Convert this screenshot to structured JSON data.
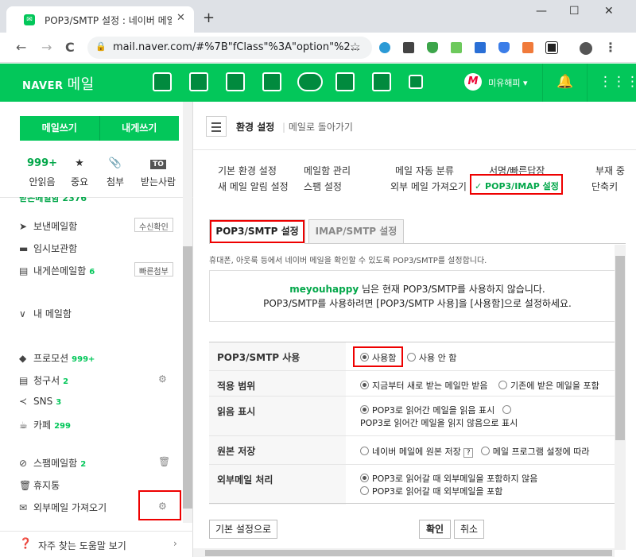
{
  "browser": {
    "tab_title": "POP3/SMTP 설정 : 네이버 메일",
    "tab_close": "✕",
    "new_tab": "+",
    "url": "mail.naver.com/#%7B\"fClass\"%3A\"option\"%2...",
    "win_min": "—",
    "win_max": "☐",
    "win_close": "✕",
    "back": "←",
    "forward": "→",
    "reload": "C",
    "menu": "⋮"
  },
  "header": {
    "brand": "NAVER",
    "product": "메일",
    "user_initial": "M",
    "user_name": "미유해피 ▾"
  },
  "sidebar": {
    "write_label": "메일쓰기",
    "self_label": "내게쓰기",
    "quick": [
      {
        "top": "999+",
        "label": "안읽음"
      },
      {
        "top": "★",
        "label": "중요"
      },
      {
        "top": "📎",
        "label": "첨부"
      },
      {
        "top": "TO",
        "label": "받는사람"
      }
    ],
    "cut_label": "받은메일함 2376",
    "sent_label": "보낸메일함",
    "sent_tag": "수신확인",
    "temp_label": "임시보관함",
    "self_box_label": "내게쓴메일함",
    "self_box_count": "6",
    "self_box_tag": "빠른첨부",
    "my_mailbox": "내 메일함",
    "promo_label": "프로모션",
    "promo_count": "999+",
    "bill_label": "청구서",
    "bill_count": "2",
    "sns_label": "SNS",
    "sns_count": "3",
    "cafe_label": "카페",
    "cafe_count": "299",
    "spam_label": "스팸메일함",
    "spam_count": "2",
    "trash_label": "휴지통",
    "external_label": "외부메일 가져오기",
    "help_label": "자주 찾는 도움말 보기"
  },
  "content": {
    "title": "환경 설정",
    "back_link": "메일로 돌아가기",
    "menu": [
      {
        "label": "기본 환경 설정"
      },
      {
        "label": "새 메일 알림 설정"
      },
      {
        "label": "메일함 관리"
      },
      {
        "label": "스팸 설정"
      },
      {
        "label": "메일 자동 분류"
      },
      {
        "label": "외부 메일 가져오기"
      },
      {
        "label": "서명/빠른답장"
      },
      {
        "label": "✓ POP3/IMAP 설정"
      },
      {
        "label": "부재 중"
      },
      {
        "label": "단축키"
      }
    ],
    "tab_active": "POP3/SMTP 설정",
    "tab_inactive": "IMAP/SMTP 설정",
    "description": "휴대폰, 아웃룩 등에서 네이버 메일을 확인할 수 있도록 POP3/SMTP를 설정합니다.",
    "notice_user": "meyouhappy",
    "notice_line1_rest": " 님은 현재 POP3/SMTP를 사용하지 않습니다.",
    "notice_line2": "POP3/SMTP를 사용하려면 [POP3/SMTP 사용]을 [사용함]으로 설정하세요.",
    "form": {
      "use_label": "POP3/SMTP 사용",
      "use_on": "사용함",
      "use_off": "사용 안 함",
      "scope_label": "적용 범위",
      "scope_opt1": "지금부터 새로 받는 메일만 받음",
      "scope_opt2": "기존에 받은 메일을 포함",
      "read_label": "읽음 표시",
      "read_opt1": "POP3로 읽어간 메일을 읽음 표시",
      "read_opt2": "POP3로 읽어간 메일을 읽지 않음으로 표시",
      "orig_label": "원본 저장",
      "orig_opt1": "네이버 메일에 원본 저장",
      "orig_help": "?",
      "orig_opt2": "메일 프로그램 설정에 따라",
      "ext_label": "외부메일 처리",
      "ext_opt1": "POP3로 읽어갈 때 외부메일을 포함하지 않음",
      "ext_opt2": "POP3로 읽어갈 때 외부메일을 포함"
    },
    "btn_default": "기본 설정으로",
    "btn_ok": "확인",
    "btn_cancel": "취소"
  },
  "colors": {
    "brand_green": "#03c75a",
    "highlight_red": "#e00000"
  }
}
